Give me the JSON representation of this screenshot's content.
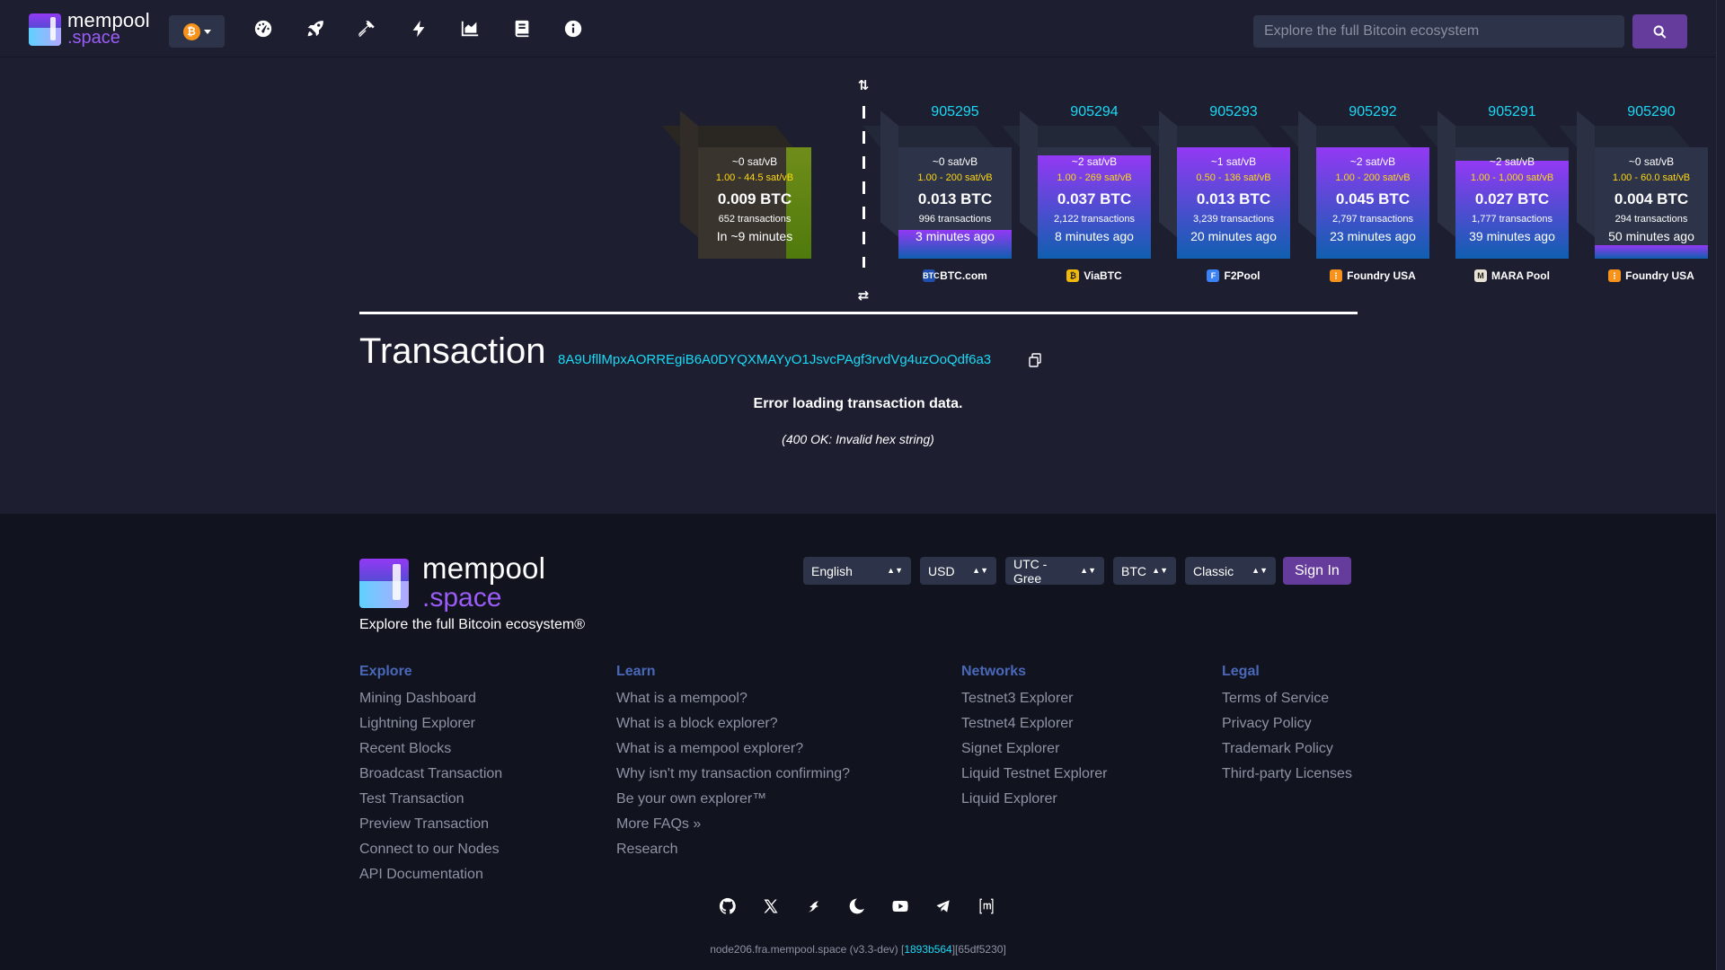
{
  "header": {
    "logo": {
      "line1": "mempool",
      "line2": ".space"
    },
    "network_icon": "bitcoin-icon",
    "nav": [
      {
        "name": "dashboard",
        "icon": "gauge-icon"
      },
      {
        "name": "accelerate",
        "icon": "rocket-icon"
      },
      {
        "name": "mining",
        "icon": "hammer-icon"
      },
      {
        "name": "lightning",
        "icon": "bolt-icon"
      },
      {
        "name": "graphs",
        "icon": "area-chart-icon"
      },
      {
        "name": "docs",
        "icon": "book-icon"
      },
      {
        "name": "about",
        "icon": "info-icon"
      }
    ],
    "search_placeholder": "Explore the full Bitcoin ecosystem"
  },
  "blockchain": {
    "mempool_block": {
      "fee": "~0 sat/vB",
      "range": "1.00 - 44.5 sat/vB",
      "amount": "0.009 BTC",
      "txs": "652 transactions",
      "eta": "In ~9 minutes"
    },
    "blocks": [
      {
        "height": "905295",
        "fee": "~0 sat/vB",
        "range": "1.00 - 200 sat/vB",
        "amount": "0.013 BTC",
        "txs": "996 transactions",
        "time": "3 minutes ago",
        "pool": "BTC.com",
        "pool_icon": "btccom-icon",
        "fill": 0.26
      },
      {
        "height": "905294",
        "fee": "~2 sat/vB",
        "range": "1.00 - 269 sat/vB",
        "amount": "0.037 BTC",
        "txs": "2,122 transactions",
        "time": "8 minutes ago",
        "pool": "ViaBTC",
        "pool_icon": "viabtc-icon",
        "fill": 0.93
      },
      {
        "height": "905293",
        "fee": "~1 sat/vB",
        "range": "0.50 - 136 sat/vB",
        "amount": "0.013 BTC",
        "txs": "3,239 transactions",
        "time": "20 minutes ago",
        "pool": "F2Pool",
        "pool_icon": "f2pool-icon",
        "fill": 1.0
      },
      {
        "height": "905292",
        "fee": "~2 sat/vB",
        "range": "1.00 - 200 sat/vB",
        "amount": "0.045 BTC",
        "txs": "2,797 transactions",
        "time": "23 minutes ago",
        "pool": "Foundry USA",
        "pool_icon": "foundry-icon",
        "fill": 1.0
      },
      {
        "height": "905291",
        "fee": "~2 sat/vB",
        "range": "1.00 - 1,000 sat/vB",
        "amount": "0.027 BTC",
        "txs": "1,777 transactions",
        "time": "39 minutes ago",
        "pool": "MARA Pool",
        "pool_icon": "mara-icon",
        "fill": 0.88
      },
      {
        "height": "905290",
        "fee": "~0 sat/vB",
        "range": "1.00 - 60.0 sat/vB",
        "amount": "0.004 BTC",
        "txs": "294 transactions",
        "time": "50 minutes ago",
        "pool": "Foundry USA",
        "pool_icon": "foundry-icon",
        "fill": 0.12
      }
    ]
  },
  "transaction": {
    "title": "Transaction",
    "id": "8A9UfllMpxAORREgiB6A0DYQXMAYyO1JsvcPAgf3rvdVg4uzOoQdf6a3",
    "error_title": "Error loading transaction data.",
    "error_detail": "(400 OK: Invalid hex string)"
  },
  "footer": {
    "logo": {
      "line1": "mempool",
      "line2": ".space"
    },
    "tagline": "Explore the full Bitcoin ecosystem®",
    "selects": {
      "language": "English",
      "currency": "USD",
      "timezone": "UTC - Gree",
      "unit": "BTC",
      "theme": "Classic"
    },
    "signin": "Sign In",
    "columns": [
      {
        "title": "Explore",
        "links": [
          "Mining Dashboard",
          "Lightning Explorer",
          "Recent Blocks",
          "Broadcast Transaction",
          "Test Transaction",
          "Preview Transaction",
          "Connect to our Nodes",
          "API Documentation"
        ]
      },
      {
        "title": "Learn",
        "links": [
          "What is a mempool?",
          "What is a block explorer?",
          "What is a mempool explorer?",
          "Why isn't my transaction confirming?",
          "Be your own explorer™",
          "More FAQs »",
          "Research"
        ]
      },
      {
        "title": "Networks",
        "links": [
          "Testnet3 Explorer",
          "Testnet4 Explorer",
          "Signet Explorer",
          "Liquid Testnet Explorer",
          "Liquid Explorer"
        ]
      },
      {
        "title": "Legal",
        "links": [
          "Terms of Service",
          "Privacy Policy",
          "Trademark Policy",
          "Third-party Licenses"
        ]
      }
    ],
    "socials": [
      "github-icon",
      "x-icon",
      "nostr-icon",
      "bluesky-icon",
      "youtube-icon",
      "telegram-icon",
      "matrix-icon"
    ],
    "build": {
      "node": "node206.fra.mempool.space (v3.3-dev) [",
      "hash": "1893b564",
      "tail": "][65df5230]"
    }
  }
}
